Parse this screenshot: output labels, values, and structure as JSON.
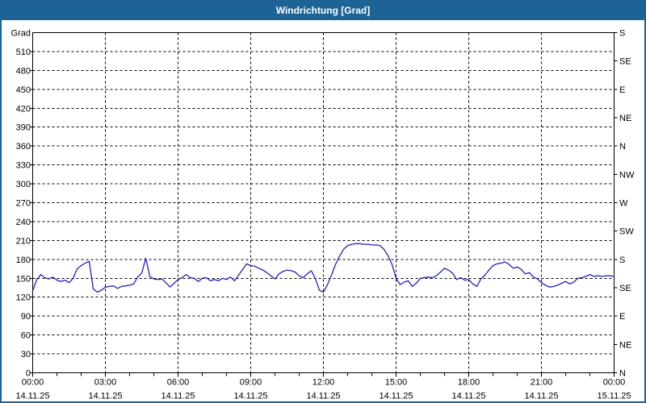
{
  "window": {
    "title": "Windrichtung [Grad]"
  },
  "colors": {
    "frame": "#1d6396",
    "titlebar_bg": "#1d6396",
    "title_text": "#ffffff",
    "plot_bg": "#ffffff",
    "grid": "#000000",
    "axis": "#000000",
    "tick_text": "#000000",
    "line": "#2222c0"
  },
  "chart_data": {
    "type": "line",
    "title": "Windrichtung [Grad]",
    "y_left_unit_label": "Grad",
    "ylim": [
      0,
      540
    ],
    "y_left_ticks": [
      0,
      30,
      60,
      90,
      120,
      150,
      180,
      210,
      240,
      270,
      300,
      330,
      360,
      390,
      420,
      450,
      480,
      510
    ],
    "y_right_ticks": [
      {
        "deg": 0,
        "label": "N"
      },
      {
        "deg": 45,
        "label": "NE"
      },
      {
        "deg": 90,
        "label": "E"
      },
      {
        "deg": 135,
        "label": "SE"
      },
      {
        "deg": 180,
        "label": "S"
      },
      {
        "deg": 225,
        "label": "SW"
      },
      {
        "deg": 270,
        "label": "W"
      },
      {
        "deg": 315,
        "label": "NW"
      },
      {
        "deg": 360,
        "label": "N"
      },
      {
        "deg": 405,
        "label": "NE"
      },
      {
        "deg": 450,
        "label": "E"
      },
      {
        "deg": 495,
        "label": "SE"
      },
      {
        "deg": 540,
        "label": "S"
      }
    ],
    "xlim_hours": [
      0,
      24
    ],
    "x_minor_tick_hours": 1,
    "x_major_ticks": [
      {
        "time": "00:00",
        "date": "14.11.25"
      },
      {
        "time": "03:00",
        "date": "14.11.25"
      },
      {
        "time": "06:00",
        "date": "14.11.25"
      },
      {
        "time": "09:00",
        "date": "14.11.25"
      },
      {
        "time": "12:00",
        "date": "14.11.25"
      },
      {
        "time": "15:00",
        "date": "14.11.25"
      },
      {
        "time": "18:00",
        "date": "14.11.25"
      },
      {
        "time": "21:00",
        "date": "14.11.25"
      },
      {
        "time": "00:00",
        "date": "15.11.25"
      }
    ],
    "grid": "dashed",
    "series": [
      {
        "name": "Windrichtung",
        "unit": "Grad",
        "sample_interval_minutes": 10,
        "start_minute": 0,
        "values": [
          130,
          148,
          156,
          151,
          149,
          152,
          147,
          145,
          147,
          143,
          150,
          165,
          170,
          174,
          177,
          133,
          128,
          131,
          136,
          137,
          138,
          134,
          137,
          138,
          139,
          141,
          152,
          158,
          182,
          153,
          149,
          148,
          149,
          143,
          136,
          142,
          148,
          151,
          156,
          151,
          150,
          145,
          150,
          151,
          146,
          148,
          146,
          150,
          148,
          152,
          146,
          155,
          164,
          173,
          170,
          169,
          166,
          163,
          159,
          154,
          149,
          157,
          161,
          163,
          162,
          160,
          154,
          151,
          157,
          162,
          150,
          131,
          128,
          140,
          155,
          172,
          185,
          196,
          202,
          204,
          205,
          205,
          204,
          204,
          203,
          203,
          202,
          196,
          186,
          172,
          150,
          140,
          144,
          146,
          137,
          142,
          150,
          151,
          152,
          151,
          154,
          160,
          166,
          163,
          158,
          148,
          151,
          147,
          148,
          141,
          137,
          149,
          155,
          163,
          170,
          173,
          174,
          176,
          172,
          166,
          168,
          164,
          157,
          159,
          152,
          149,
          143,
          139,
          136,
          137,
          139,
          142,
          145,
          141,
          144,
          150,
          151,
          153,
          156,
          153,
          154,
          153,
          154,
          154,
          153
        ]
      }
    ]
  }
}
